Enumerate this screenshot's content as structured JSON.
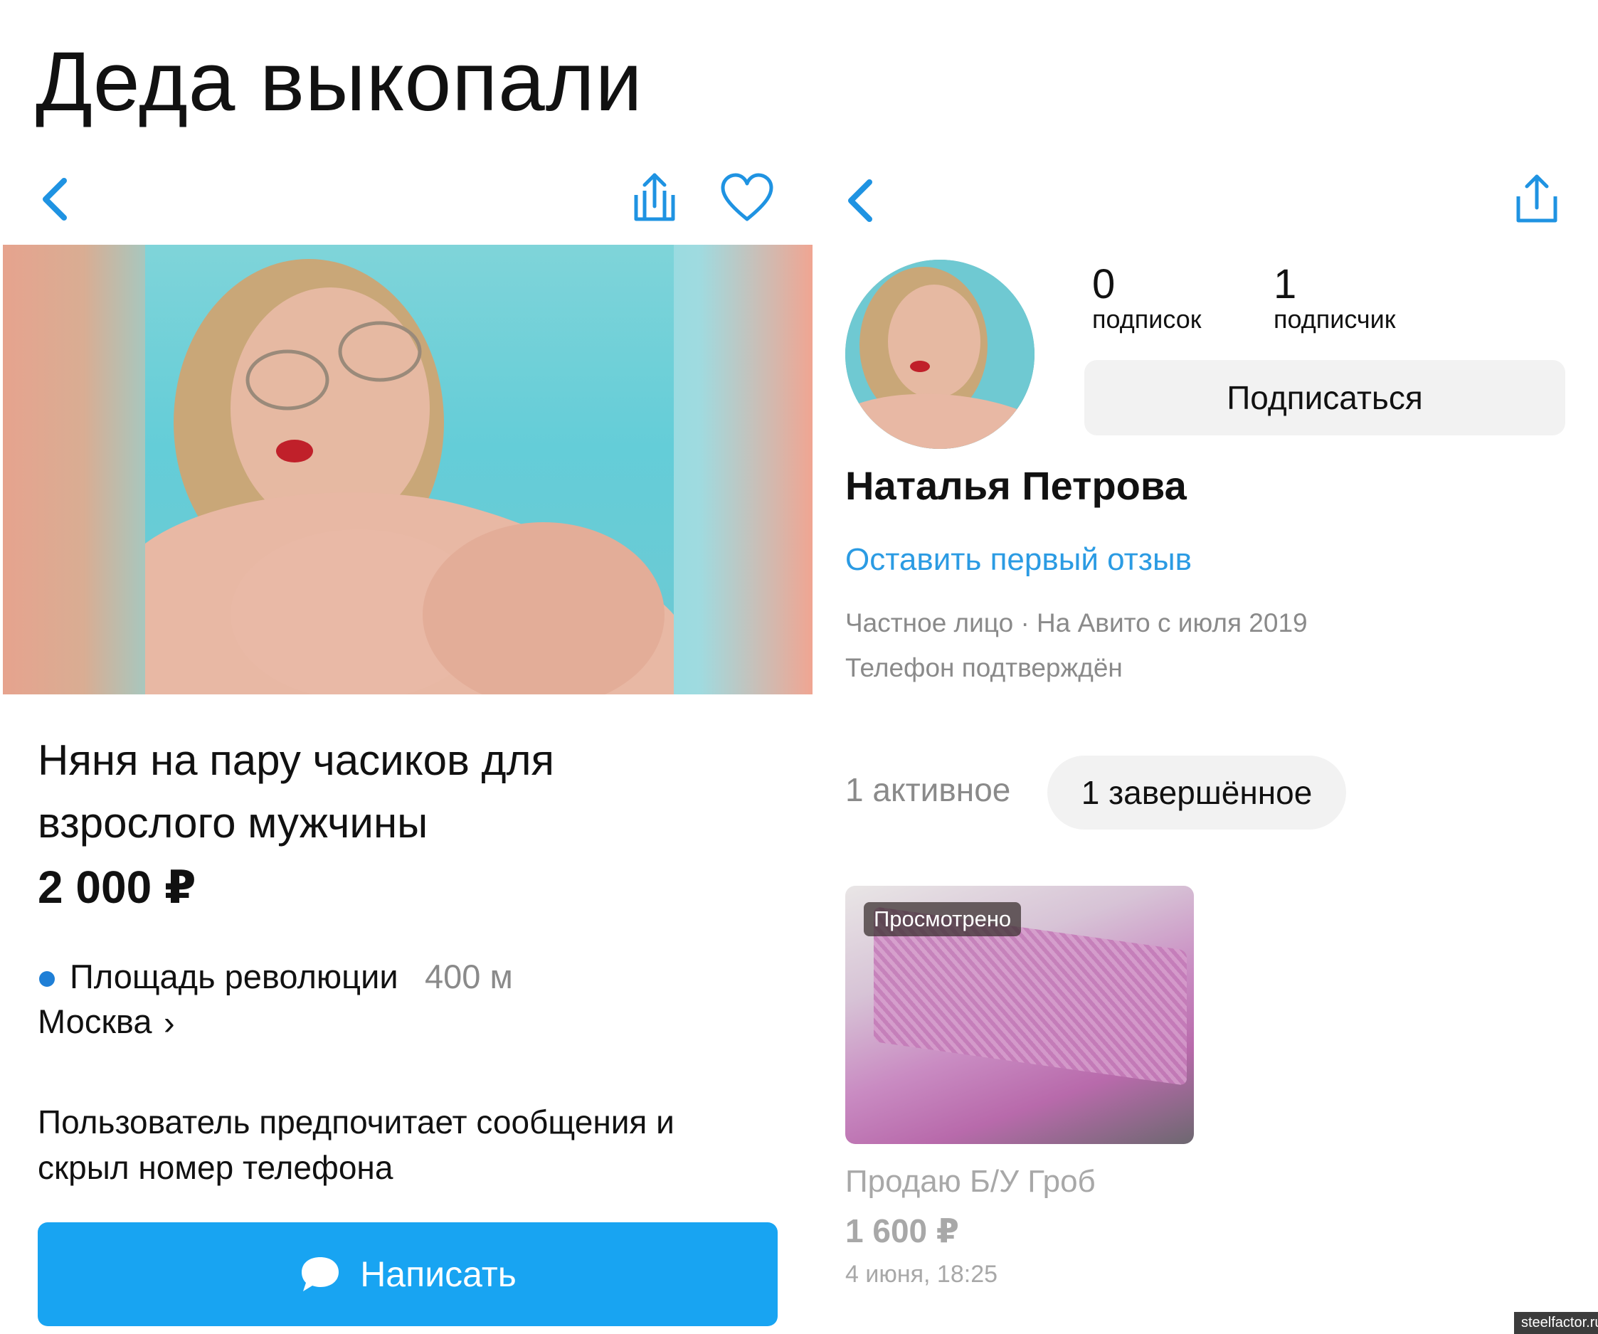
{
  "caption": "Деда выкопали",
  "listing": {
    "title": "Няня на пару часиков для взрослого мужчины",
    "price": "2 000 ₽",
    "metro": "Площадь революции",
    "metro_distance": "400 м",
    "city": "Москва",
    "contact_note": "Пользователь предпочитает сообщения и скрыл номер телефона",
    "write_label": "Написать"
  },
  "profile": {
    "subscriptions_count": "0",
    "subscriptions_label": "подписок",
    "followers_count": "1",
    "followers_label": "подписчик",
    "subscribe_label": "Подписаться",
    "name": "Наталья Петрова",
    "review_link": "Оставить первый отзыв",
    "meta_line": "Частное лицо · На Авито с июля 2019",
    "phone_status": "Телефон подтверждён",
    "tab_active": "1 активное",
    "tab_completed": "1 завершённое"
  },
  "ad_card": {
    "badge": "Просмотрено",
    "title": "Продаю Б/У Гроб",
    "price": "1 600 ₽",
    "date": "4 июня, 18:25"
  },
  "watermark": "steelfactor.ru",
  "colors": {
    "accent_blue": "#18a4f2",
    "link_blue": "#2b9be3",
    "metro_dot": "#1f7fd6"
  }
}
